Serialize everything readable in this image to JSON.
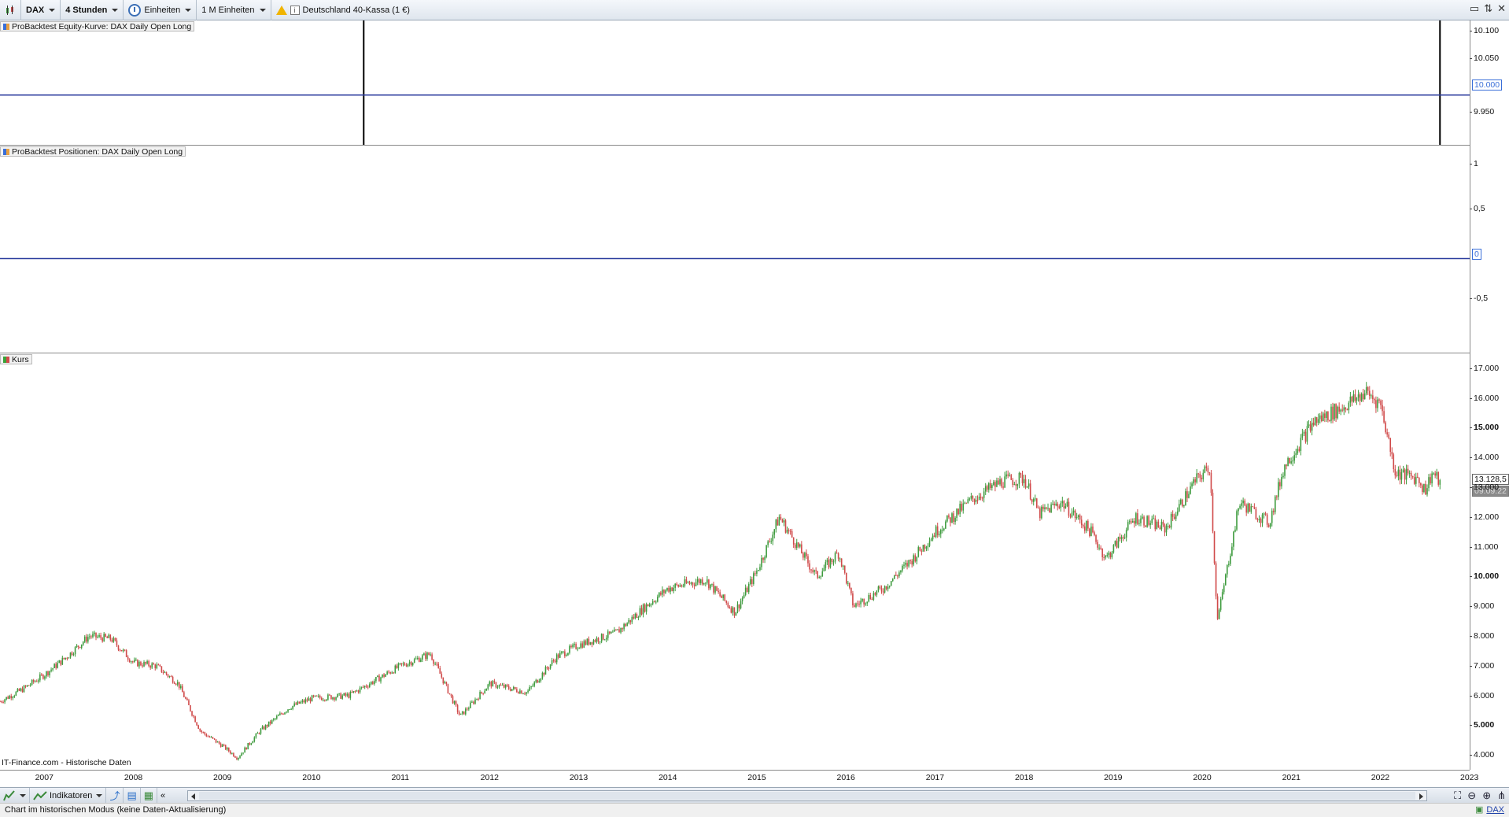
{
  "toolbar": {
    "symbol": "DAX",
    "timeframe": "4 Stunden",
    "units_label": "Einheiten",
    "units_count": "1 M Einheiten",
    "instrument": "Deutschland 40-Kassa (1 €)",
    "window_controls": [
      "▭",
      "⇅",
      "✕"
    ]
  },
  "panels": {
    "equity": {
      "label": "ProBacktest Equity-Kurve: DAX Daily Open Long",
      "ticks": [
        "10.100",
        "10.050",
        "9.950"
      ],
      "current_value": "10.000"
    },
    "positions": {
      "label": "ProBacktest Positionen: DAX Daily Open Long",
      "ticks": [
        "1",
        "0,5",
        "-0,5"
      ],
      "current_value": "0"
    },
    "price": {
      "label": "Kurs",
      "ticks": [
        "17.000",
        "16.000",
        "15.000",
        "14.000",
        "13.000",
        "12.000",
        "11.000",
        "10.000",
        "9.000",
        "8.000",
        "7.000",
        "6.000",
        "5.000",
        "4.000"
      ],
      "last_price": "13.128,5",
      "last_date": "09.09.22",
      "source": "IT-Finance.com - Historische Daten"
    }
  },
  "xaxis": {
    "years": [
      "2007",
      "2008",
      "2009",
      "2010",
      "2011",
      "2012",
      "2013",
      "2014",
      "2015",
      "2016",
      "2017",
      "2018",
      "2019",
      "2020",
      "2021",
      "2022",
      "2023"
    ]
  },
  "bottombar": {
    "indicators_label": "Indikatoren",
    "collapse_label": "«"
  },
  "status": {
    "text": "Chart im historischen Modus (keine Daten-Aktualisierung)",
    "right_link": "DAX"
  },
  "colors": {
    "up": "#3e9b3e",
    "down": "#d04a4a",
    "line": "#2c3d9e",
    "marker": "#000000"
  },
  "chart_data": {
    "type": "candlestick",
    "title": "Kurs",
    "ylim": [
      3500,
      17500
    ],
    "x_range": [
      "2006-07",
      "2023-01"
    ],
    "series": [
      {
        "name": "Kurs",
        "x": [
          "2006-07",
          "2006-10",
          "2007-01",
          "2007-04",
          "2007-07",
          "2007-10",
          "2008-01",
          "2008-04",
          "2008-07",
          "2008-10",
          "2009-01",
          "2009-03",
          "2009-06",
          "2009-10",
          "2010-01",
          "2010-06",
          "2011-01",
          "2011-05",
          "2011-09",
          "2012-01",
          "2012-06",
          "2012-10",
          "2013-01",
          "2013-06",
          "2013-10",
          "2014-01",
          "2014-06",
          "2014-10",
          "2015-01",
          "2015-04",
          "2015-06",
          "2015-09",
          "2015-12",
          "2016-02",
          "2016-06",
          "2016-10",
          "2017-01",
          "2017-06",
          "2017-10",
          "2018-01",
          "2018-03",
          "2018-06",
          "2018-10",
          "2018-12",
          "2019-04",
          "2019-08",
          "2019-12",
          "2020-02",
          "2020-03",
          "2020-06",
          "2020-10",
          "2020-12",
          "2021-04",
          "2021-08",
          "2021-11",
          "2022-01",
          "2022-03",
          "2022-06",
          "2022-07",
          "2022-08",
          "2022-09"
        ],
        "y": [
          5800,
          6200,
          6700,
          7300,
          8000,
          7900,
          7100,
          7000,
          6400,
          4800,
          4300,
          3900,
          4800,
          5600,
          5900,
          6000,
          7000,
          7400,
          5300,
          6400,
          6100,
          7300,
          7700,
          8100,
          9000,
          9600,
          9900,
          8800,
          10200,
          12000,
          11200,
          10000,
          10800,
          9000,
          9600,
          10600,
          11500,
          12600,
          13200,
          13300,
          12100,
          12500,
          11500,
          10600,
          12000,
          11600,
          13200,
          13700,
          8500,
          12500,
          11800,
          13700,
          15200,
          15700,
          16200,
          15800,
          13500,
          13300,
          12900,
          13500,
          13128.5
        ]
      }
    ],
    "equity_curve": {
      "name": "ProBacktest Equity-Kurve: DAX Daily Open Long",
      "value": 10000,
      "ylim": [
        9920,
        10120
      ]
    },
    "positions": {
      "name": "ProBacktest Positionen: DAX Daily Open Long",
      "value": 0,
      "ylim": [
        -1,
        1.2
      ]
    },
    "markers": [
      "2010-08",
      "2022-09"
    ]
  }
}
